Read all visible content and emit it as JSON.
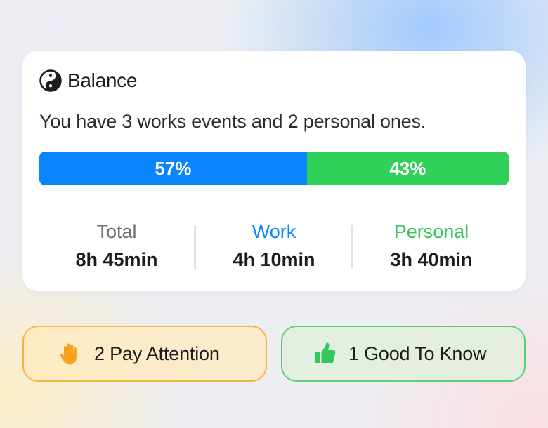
{
  "balance_card": {
    "title": "Balance",
    "icon": "yin-yang-icon",
    "summary": "You have 3 works events and 2 personal ones.",
    "split": {
      "work": {
        "percent": 57,
        "label": "57%",
        "color": "#0a84ff"
      },
      "personal": {
        "percent": 43,
        "label": "43%",
        "color": "#30d158"
      }
    },
    "stats": [
      {
        "label": "Total",
        "value": "8h 45min",
        "color": "#6e6e73"
      },
      {
        "label": "Work",
        "value": "4h 10min",
        "color": "#0a84ff"
      },
      {
        "label": "Personal",
        "value": "3h 40min",
        "color": "#34c759"
      }
    ]
  },
  "insights": {
    "attention": {
      "label": "2 Pay Attention",
      "icon": "raised-hand-icon",
      "accent": "#f6b443"
    },
    "good": {
      "label": "1 Good To Know",
      "icon": "thumbs-up-icon",
      "accent": "#34c759"
    }
  }
}
